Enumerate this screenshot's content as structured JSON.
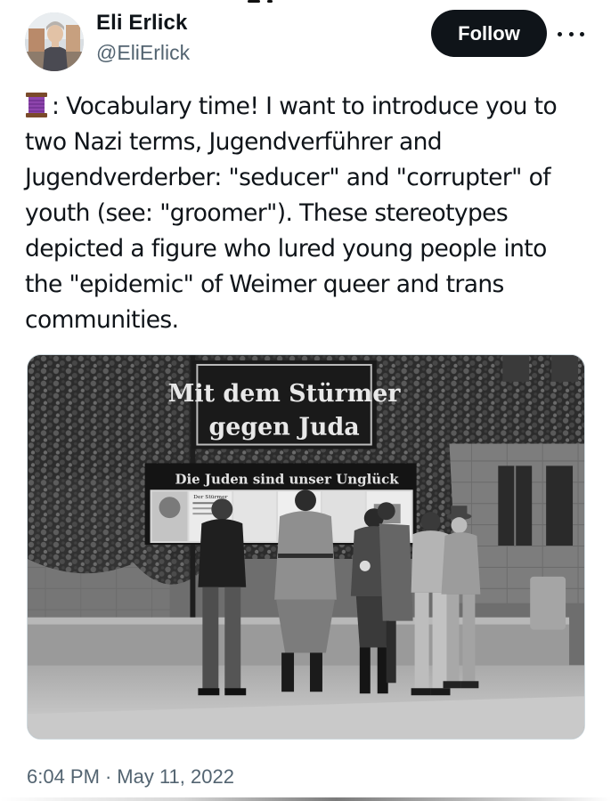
{
  "author": {
    "name": "Eli Erlick",
    "handle": "@EliErlick"
  },
  "actions": {
    "follow_label": "Follow",
    "more_icon": "more-horizontal-icon"
  },
  "tweet": {
    "lines": [
      ": Vocabulary time! I want to introduce you to",
      "two Nazi terms, Jugendverführer and",
      "Jugendverderber: \"seducer\" and \"corrupter\" of",
      "youth (see: \"groomer\"). These stereotypes",
      "depicted a figure who lured young people into",
      "the \"epidemic\" of Weimer queer and trans",
      "communities."
    ],
    "leading_icon": "spool-of-thread-icon"
  },
  "photo": {
    "sign_line1": "Mit dem Stürmer",
    "sign_line2": "gegen Juda",
    "board_header": "Die Juden sind unser Unglück",
    "newspaper_mast": "Der Stürmer"
  },
  "meta": {
    "time": "6:04 PM",
    "separator": "·",
    "date": "May 11, 2022"
  }
}
